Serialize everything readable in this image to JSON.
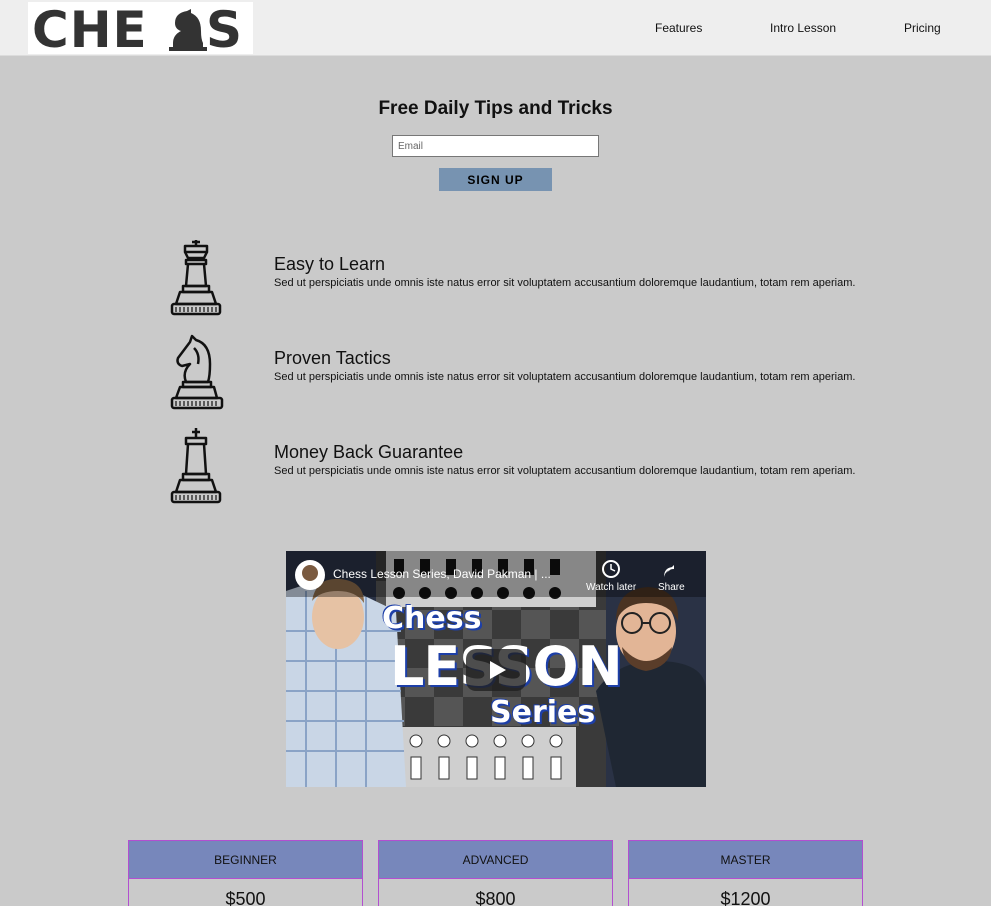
{
  "nav": {
    "logo_text": "CHESS",
    "links": [
      "Features",
      "Intro Lesson",
      "Pricing"
    ]
  },
  "hero": {
    "title": "Free Daily Tips and Tricks",
    "email_placeholder": "Email",
    "signup_label": "SIGN UP"
  },
  "features": [
    {
      "icon": "queen-icon",
      "title": "Easy to Learn",
      "text": "Sed ut perspiciatis unde omnis iste natus error sit voluptatem accusantium doloremque laudantium, totam rem aperiam."
    },
    {
      "icon": "knight-icon",
      "title": "Proven Tactics",
      "text": "Sed ut perspiciatis unde omnis iste natus error sit voluptatem accusantium doloremque laudantium, totam rem aperiam."
    },
    {
      "icon": "king-icon",
      "title": "Money Back Guarantee",
      "text": "Sed ut perspiciatis unde omnis iste natus error sit voluptatem accusantium doloremque laudantium, totam rem aperiam."
    }
  ],
  "video": {
    "title": "Chess Lesson Series, David Pakman | ...",
    "watch_later": "Watch later",
    "share": "Share",
    "thumb_line1": "Chess",
    "thumb_line2": "LESSON",
    "thumb_line3": "Series"
  },
  "pricing": [
    {
      "tier": "BEGINNER",
      "price": "$500"
    },
    {
      "tier": "ADVANCED",
      "price": "$800"
    },
    {
      "tier": "MASTER",
      "price": "$1200"
    }
  ],
  "colors": {
    "background": "#cacaca",
    "nav_bg": "#eeeeee",
    "signup_bg": "#7793b1",
    "card_head_bg": "#7787bb",
    "card_border": "#b24fd0"
  }
}
